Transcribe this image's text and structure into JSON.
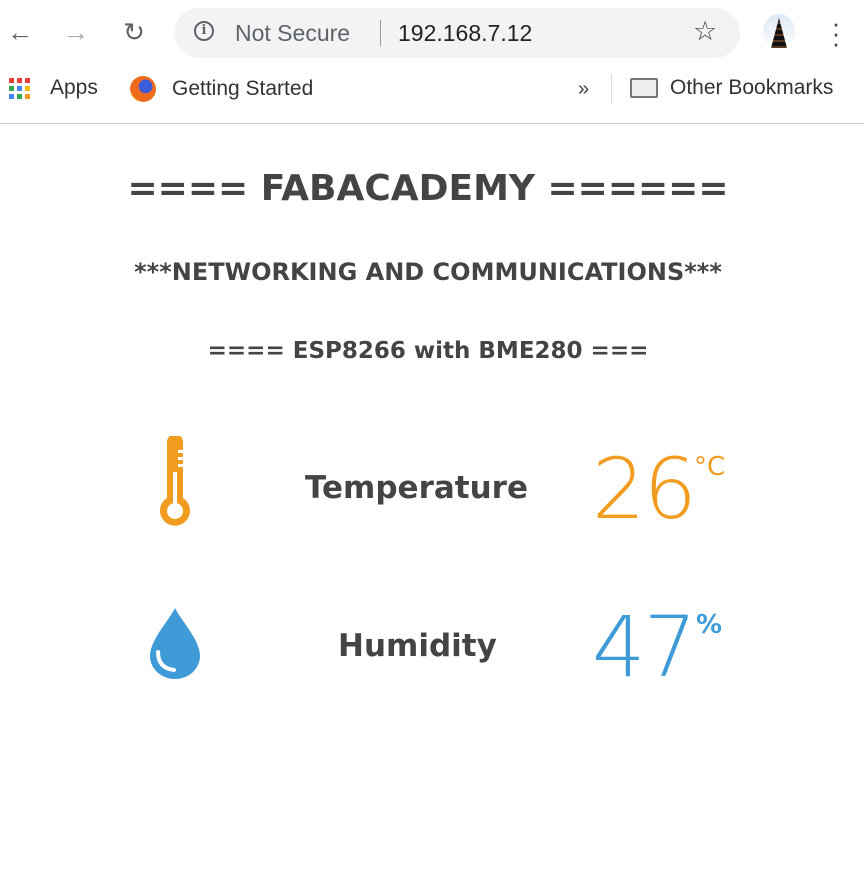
{
  "browser": {
    "security_label": "Not Secure",
    "url": "192.168.7.12",
    "icons": [
      "back-arrow-icon",
      "forward-arrow-icon",
      "reload-icon",
      "info-icon",
      "star-icon",
      "avatar",
      "menu-icon"
    ],
    "bookmarks": [
      {
        "label": "Apps",
        "icon": "apps-grid-icon"
      },
      {
        "label": "Getting Started",
        "icon": "firefox-icon"
      }
    ],
    "overflow_label": "»",
    "other_bookmarks": "Other Bookmarks"
  },
  "page": {
    "title": "==== FABACADEMY ======",
    "subtitle": "***NETWORKING AND COMMUNICATIONS***",
    "heading": "==== ESP8266 with BME280 ===",
    "readings": [
      {
        "label": "Temperature",
        "value": "26",
        "unit": "°C",
        "icon": "thermometer-icon",
        "color": "#f29c1f"
      },
      {
        "label": "Humidity",
        "value": "47",
        "unit": "%",
        "icon": "water-drop-icon",
        "color": "#3f9ad8"
      }
    ]
  }
}
